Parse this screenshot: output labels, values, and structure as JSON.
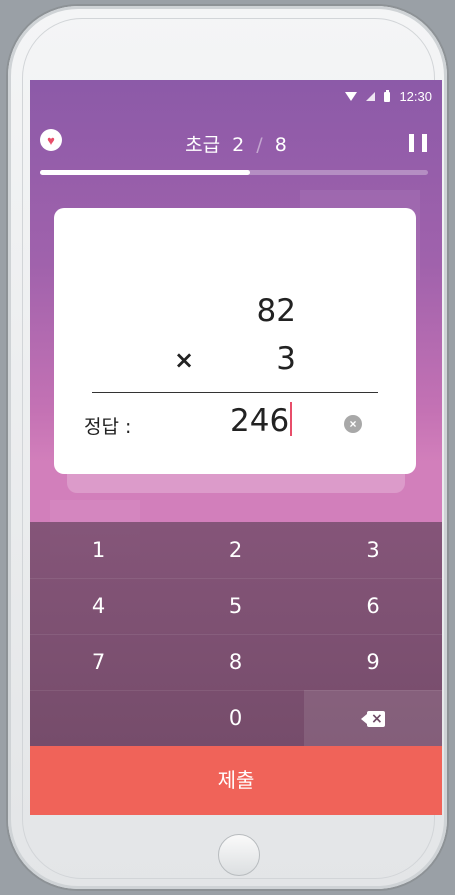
{
  "status_bar": {
    "time": "12:30"
  },
  "header": {
    "level_label": "초급",
    "current": "2",
    "separator": "/",
    "total": "8"
  },
  "progress": {
    "fraction": 0.54
  },
  "problem": {
    "operand1": "82",
    "operator": "×",
    "operand2": "3",
    "answer_label": "정답 :",
    "answer_value": "246"
  },
  "keypad": {
    "keys": [
      "1",
      "2",
      "3",
      "4",
      "5",
      "6",
      "7",
      "8",
      "9",
      "0"
    ]
  },
  "submit_label": "제출",
  "colors": {
    "accent": "#f06359",
    "heart": "#e84e6a",
    "caret": "#e84e6a"
  },
  "icons": [
    "heart-icon",
    "pause-icon",
    "clear-icon",
    "backspace-icon",
    "wifi-icon",
    "signal-icon",
    "battery-icon"
  ]
}
